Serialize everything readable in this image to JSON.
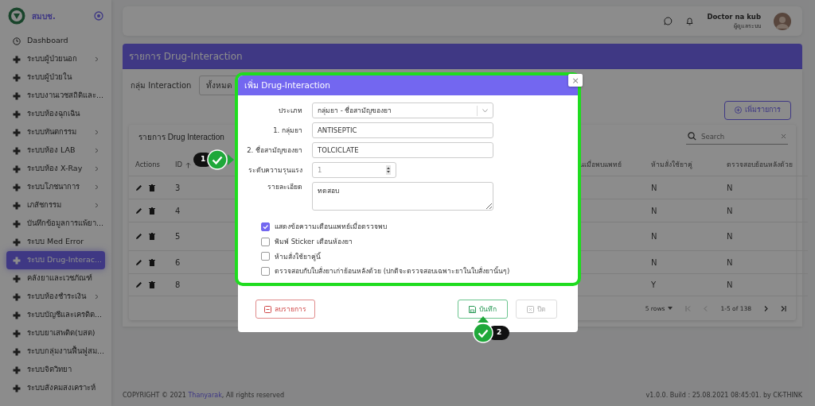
{
  "brand": {
    "name": "สมบช."
  },
  "sidebar": {
    "items": [
      {
        "label": "Dashboard",
        "selected": false,
        "submenu": false
      },
      {
        "label": "ระบบผู้ป่วยนอก",
        "selected": false,
        "submenu": true
      },
      {
        "label": "ระบบผู้ป่วยใน",
        "selected": false,
        "submenu": false
      },
      {
        "label": "ระบบงานเวชสถิติและ...",
        "selected": false,
        "submenu": false
      },
      {
        "label": "ระบบห้องฉุกเฉิน",
        "selected": false,
        "submenu": false
      },
      {
        "label": "ระบบทันตกรรม",
        "selected": false,
        "submenu": true
      },
      {
        "label": "ระบบห้อง LAB",
        "selected": false,
        "submenu": true
      },
      {
        "label": "ระบบห้อง X-Ray",
        "selected": false,
        "submenu": true
      },
      {
        "label": "ระบบโภชนาการ",
        "selected": false,
        "submenu": true
      },
      {
        "label": "เภสัชกรรม",
        "selected": false,
        "submenu": true
      },
      {
        "label": "บันทึกข้อมูลการแพ้ยา...",
        "selected": false,
        "submenu": false
      },
      {
        "label": "ระบบ Med Error",
        "selected": false,
        "submenu": false
      },
      {
        "label": "ระบบ Drug-Interac...",
        "selected": true,
        "submenu": false
      },
      {
        "label": "คลังยาและเวชภัณฑ์",
        "selected": false,
        "submenu": false
      },
      {
        "label": "ระบบห้องชำระเงิน",
        "selected": false,
        "submenu": true
      },
      {
        "label": "ระบบบัญชีและเครดิต...",
        "selected": false,
        "submenu": false
      },
      {
        "label": "ระบบยาเสพติด(บสต)",
        "selected": false,
        "submenu": false
      },
      {
        "label": "ระบบกลุ่มงานฟื้นฟูสม...",
        "selected": false,
        "submenu": false
      },
      {
        "label": "ระบบจิตวิทยา",
        "selected": false,
        "submenu": false
      },
      {
        "label": "ระบบสังคมสงเคราะห์",
        "selected": false,
        "submenu": false
      }
    ]
  },
  "user": {
    "name": "Doctor na kub",
    "role": "ผู้ดูแลระบบ"
  },
  "page_title": "รายการ Drug-Interaction",
  "filter": {
    "label": "กลุ่ม Interaction",
    "value": "ทั้งหมด"
  },
  "add_button": {
    "label": "เพิ่มรายการ"
  },
  "table": {
    "title": "รายการ Drug Interaction",
    "search_placeholder": "Search",
    "columns": [
      {
        "label": "Actions"
      },
      {
        "label": "ID",
        "sorted": true
      },
      {
        "label": "นเมื่อพบแพทย์"
      },
      {
        "label": "ห้ามสั่งใช้ยาคู่"
      },
      {
        "label": "ตรวจสอบย้อนหลังด้วย"
      }
    ],
    "rows": [
      {
        "id": "3",
        "cells": [
          "N",
          "N"
        ]
      },
      {
        "id": "4",
        "cells": [
          "N",
          "N"
        ]
      },
      {
        "id": "5",
        "cells": [
          "N",
          "N"
        ]
      },
      {
        "id": "6",
        "cells": [
          "N",
          "N"
        ]
      },
      {
        "id": "8",
        "cells": [
          "Y",
          "N"
        ]
      }
    ],
    "pagination": {
      "rows_per_page": "5 rows",
      "range": "1-5 of 138"
    }
  },
  "modal": {
    "title": "เพิ่ม Drug-Interaction",
    "close": "×",
    "fields": [
      {
        "kind": "select",
        "label": "ประเภท",
        "value": "กลุ่มยา - ชื่อสามัญของยา"
      },
      {
        "kind": "text",
        "label": "1. กลุ่มยา",
        "value": "ANTISEPTIC"
      },
      {
        "kind": "text",
        "label": "2. ชื่อสามัญของยา",
        "value": "TOLCICLATE"
      },
      {
        "kind": "number",
        "label": "ระดับความรุนแรง",
        "value": "1"
      },
      {
        "kind": "textarea",
        "label": "รายละเอียด",
        "value": "ทดสอบ"
      }
    ],
    "checkboxes": [
      {
        "label": "แสดงข้อความเตือนแพทย์เมื่อตรวจพบ",
        "checked": true
      },
      {
        "label": "พิมพ์ Sticker เตือนห้องยา",
        "checked": false
      },
      {
        "label": "ห้ามสั่งใช้ยาคู่นี้",
        "checked": false
      },
      {
        "label": "ตรวจสอบกับใบสั่งยาเก่าย้อนหลังด้วย (ปกติจะตรวจสอบเฉพาะยาในใบสั่งยานั้นๆ)",
        "checked": false
      }
    ],
    "buttons": [
      {
        "kind": "delete",
        "label": "ลบรายการ",
        "disabled": false
      },
      {
        "kind": "save",
        "label": "บันทึก",
        "disabled": false
      },
      {
        "kind": "close",
        "label": "ปิด",
        "disabled": true
      }
    ]
  },
  "annotations": [
    {
      "number": "1"
    },
    {
      "number": "2"
    }
  ],
  "footer": {
    "copyright_prefix": "COPYRIGHT © 2021",
    "link": "Thanyarak",
    "copyright_suffix": ", All rights reserved",
    "version": "v1.0.0. Build : 25.08.2021 08:45:01. by CK-THINK"
  }
}
